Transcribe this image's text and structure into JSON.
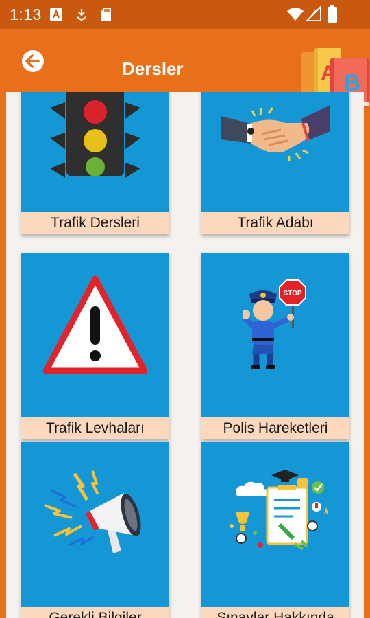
{
  "status_bar": {
    "time": "1:13"
  },
  "app_bar": {
    "title": "Dersler",
    "logo_letters": [
      "A",
      "B"
    ]
  },
  "cards": [
    {
      "label": "Trafik Dersleri",
      "icon": "traffic-light-icon"
    },
    {
      "label": "Trafik Adabı",
      "icon": "handshake-icon"
    },
    {
      "label": "Trafik Levhaları",
      "icon": "warning-sign-icon"
    },
    {
      "label": "Polis Hareketleri",
      "icon": "police-officer-icon"
    },
    {
      "label": "Gerekli Bilgiler",
      "icon": "megaphone-icon"
    },
    {
      "label": "Sınavlar Hakkında",
      "icon": "exam-icon"
    }
  ],
  "illustration_text": {
    "stop_sign": "STOP"
  },
  "colors": {
    "app_bar": "#e8701a",
    "status_bar": "#c9590f",
    "card_bg": "#1597d6",
    "label_bg": "#fdd8bd",
    "content_bg": "#f4f1ee"
  }
}
